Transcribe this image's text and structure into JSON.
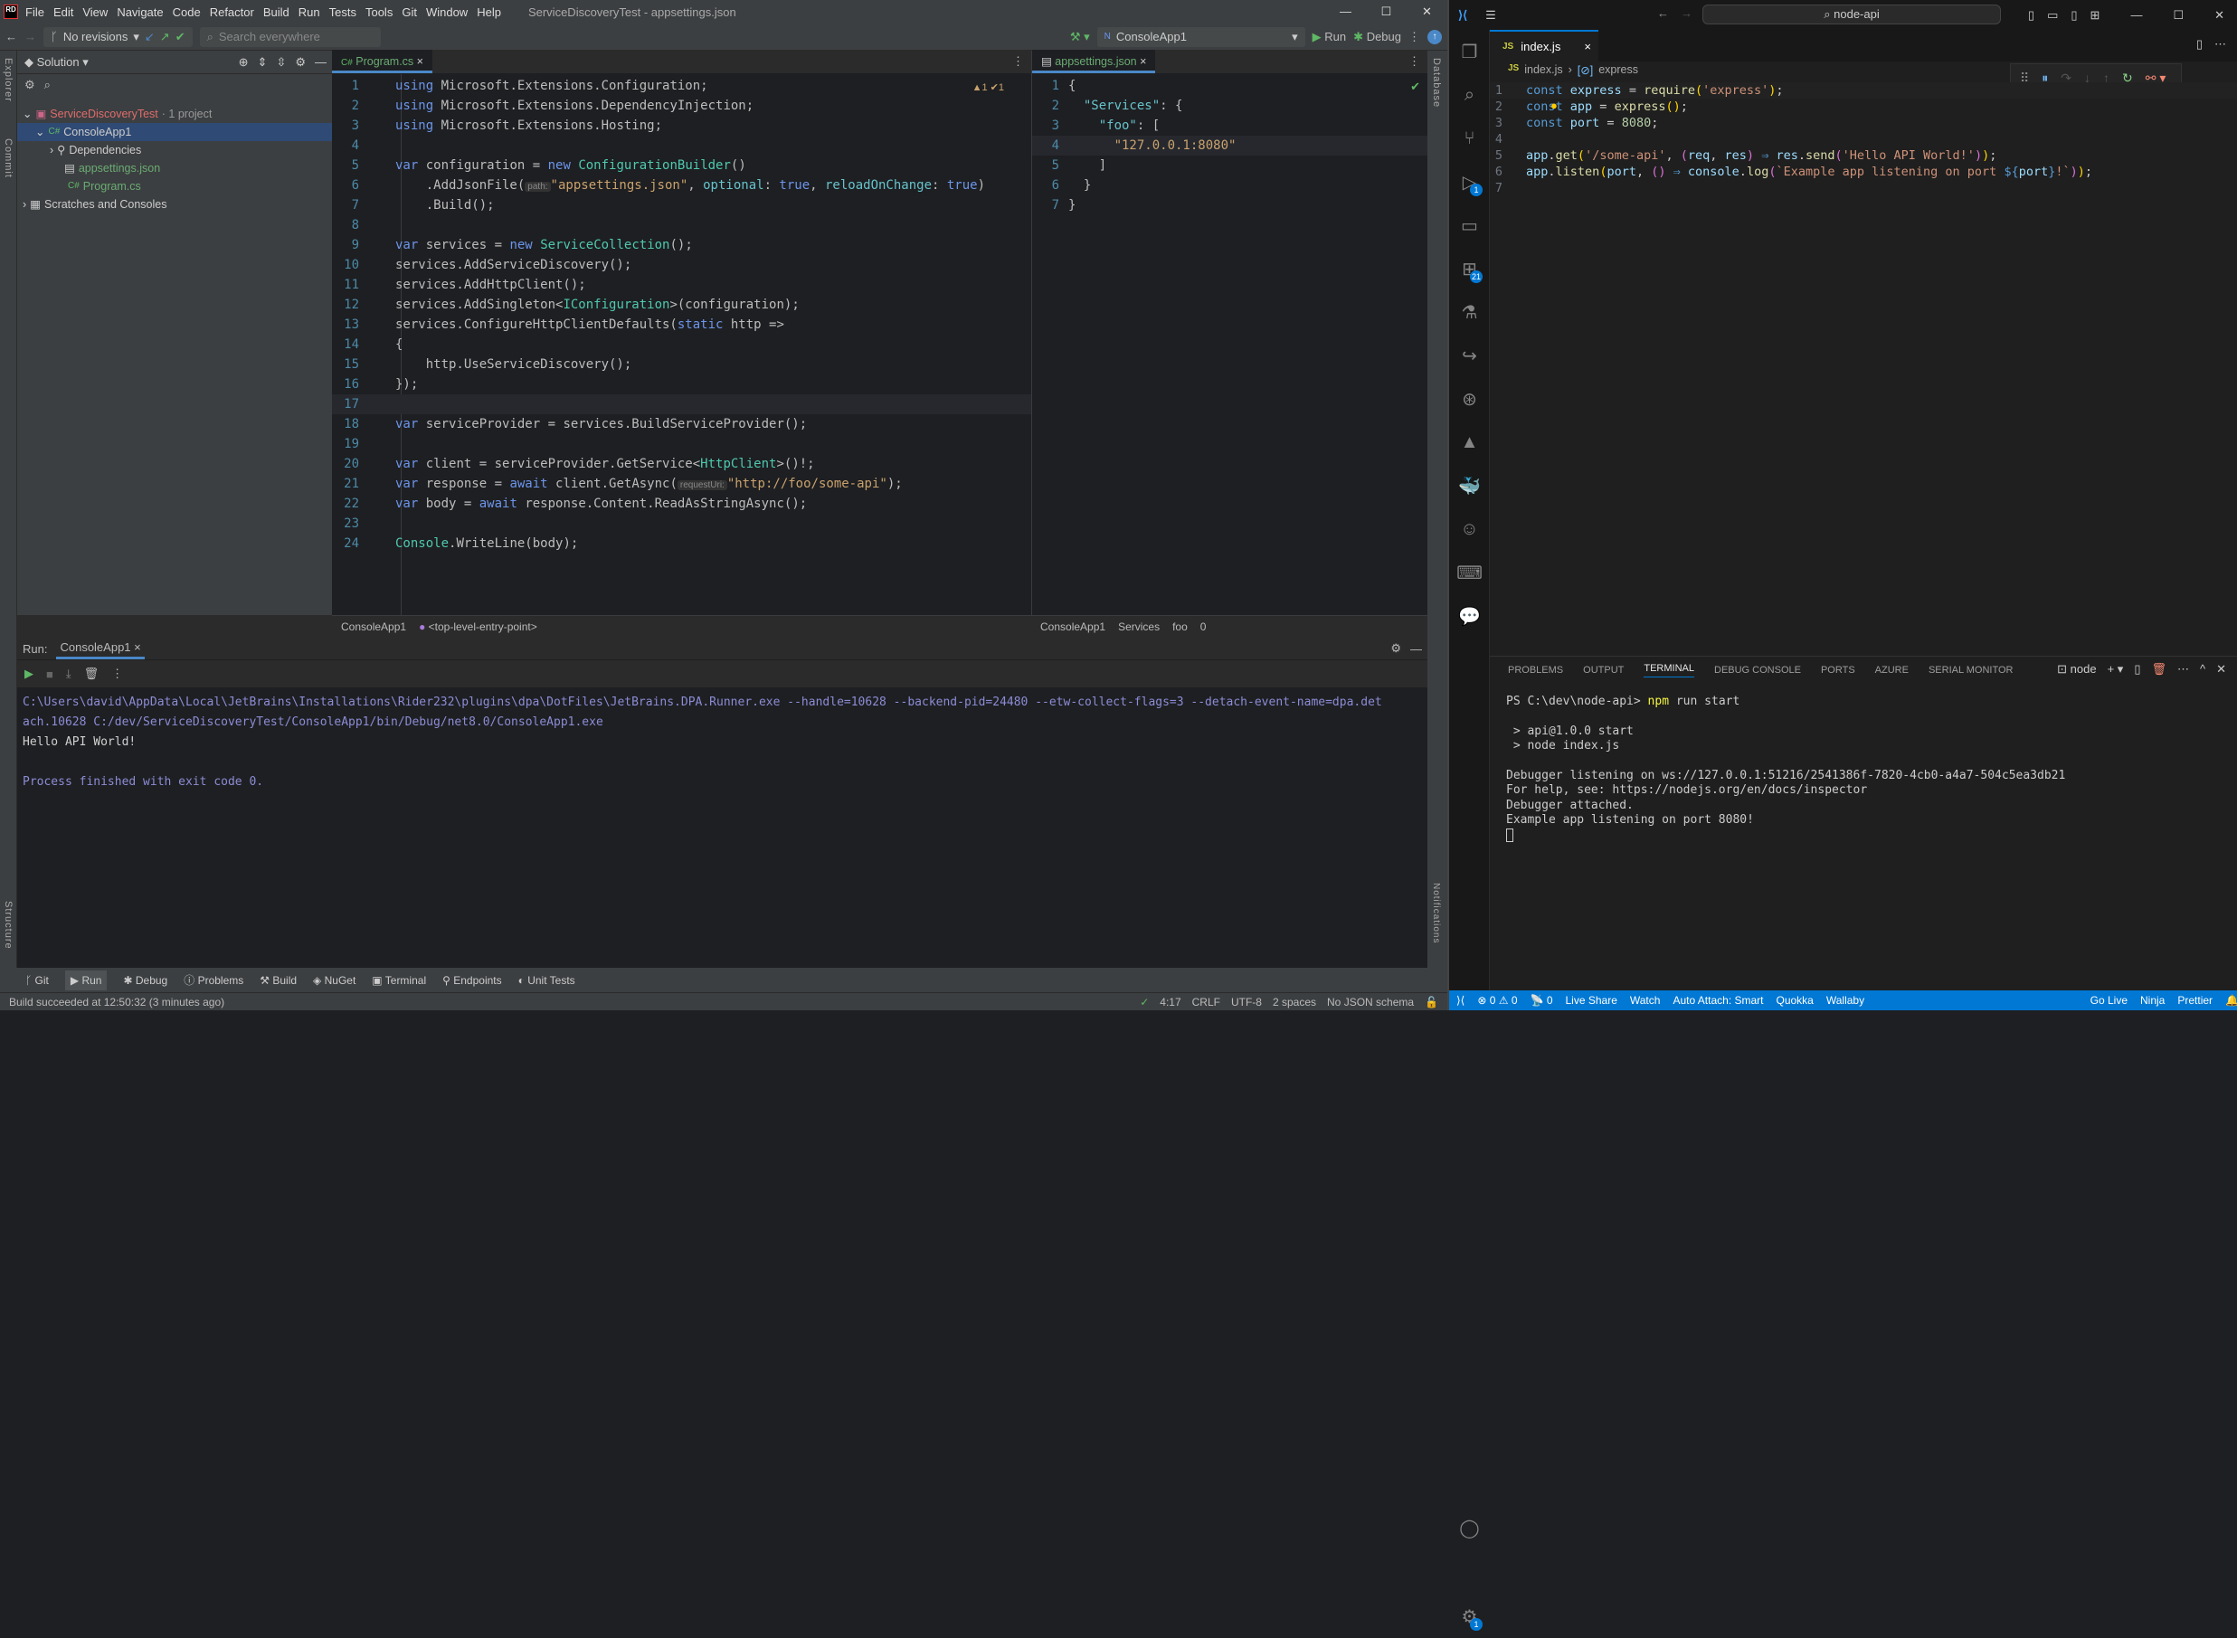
{
  "rider": {
    "logo": "RD",
    "menu": [
      "File",
      "Edit",
      "View",
      "Navigate",
      "Code",
      "Refactor",
      "Build",
      "Run",
      "Tests",
      "Tools",
      "Git",
      "Window",
      "Help"
    ],
    "window_title": "ServiceDiscoveryTest - appsettings.json",
    "toolbar": {
      "vcs": "No revisions",
      "search_placeholder": "Search everywhere",
      "run_config": "ConsoleApp1",
      "run": "Run",
      "debug": "Debug"
    },
    "left_strip": [
      "Explorer",
      "Commit",
      "Structure"
    ],
    "right_strip": [
      "Database",
      "Notifications"
    ],
    "solution": {
      "title": "Solution",
      "items": [
        {
          "label": "ServiceDiscoveryTest",
          "suffix": " · 1 project"
        },
        {
          "label": "ConsoleApp1"
        },
        {
          "label": "Dependencies"
        },
        {
          "label": "appsettings.json"
        },
        {
          "label": "Program.cs"
        },
        {
          "label": "Scratches and Consoles"
        }
      ]
    },
    "program_tab": "Program.cs",
    "inspections": "▲1 ✔1",
    "program_lines": [
      [
        [
          "using",
          "kw"
        ],
        [
          " Microsoft.Extensions.Configuration;",
          "tx"
        ]
      ],
      [
        [
          "using",
          "kw"
        ],
        [
          " Microsoft.Extensions.DependencyInjection;",
          "tx"
        ]
      ],
      [
        [
          "using",
          "kw"
        ],
        [
          " Microsoft.Extensions.Hosting;",
          "tx"
        ]
      ],
      [],
      [
        [
          "var",
          "kw"
        ],
        [
          " configuration = ",
          "tx"
        ],
        [
          "new",
          "kw"
        ],
        [
          " ",
          "tx"
        ],
        [
          "ConfigurationBuilder",
          "cls"
        ],
        [
          "()",
          "tx"
        ]
      ],
      [
        [
          "    .AddJsonFile(",
          "tx"
        ],
        [
          "path:",
          "hint"
        ],
        [
          "\"appsettings.json\"",
          "str"
        ],
        [
          ", ",
          "tx"
        ],
        [
          "optional",
          "key"
        ],
        [
          ": ",
          "tx"
        ],
        [
          "true",
          "kw"
        ],
        [
          ", ",
          "tx"
        ],
        [
          "reloadOnChange",
          "key"
        ],
        [
          ": ",
          "tx"
        ],
        [
          "true",
          "kw"
        ],
        [
          ")",
          "tx"
        ]
      ],
      [
        [
          "    .Build();",
          "tx"
        ]
      ],
      [],
      [
        [
          "var",
          "kw"
        ],
        [
          " services = ",
          "tx"
        ],
        [
          "new",
          "kw"
        ],
        [
          " ",
          "tx"
        ],
        [
          "ServiceCollection",
          "cls"
        ],
        [
          "();",
          "tx"
        ]
      ],
      [
        [
          "services.AddServiceDiscovery();",
          "tx"
        ]
      ],
      [
        [
          "services.AddHttpClient();",
          "tx"
        ]
      ],
      [
        [
          "services.AddSingleton<",
          "tx"
        ],
        [
          "IConfiguration",
          "cls"
        ],
        [
          ">(configuration);",
          "tx"
        ]
      ],
      [
        [
          "services.ConfigureHttpClientDefaults(",
          "tx"
        ],
        [
          "static",
          "kw"
        ],
        [
          " http =>",
          "tx"
        ]
      ],
      [
        [
          "{",
          "tx"
        ]
      ],
      [
        [
          "    http.UseServiceDiscovery();",
          "tx"
        ]
      ],
      [
        [
          "});",
          "tx"
        ]
      ],
      [],
      [
        [
          "var",
          "kw"
        ],
        [
          " serviceProvider = services.BuildServiceProvider();",
          "tx"
        ]
      ],
      [],
      [
        [
          "var",
          "kw"
        ],
        [
          " client = serviceProvider.GetService<",
          "tx"
        ],
        [
          "HttpClient",
          "cls"
        ],
        [
          ">()!;",
          "tx"
        ]
      ],
      [
        [
          "var",
          "kw"
        ],
        [
          " response = ",
          "tx"
        ],
        [
          "await",
          "kw"
        ],
        [
          " client.GetAsync(",
          "tx"
        ],
        [
          "requestUri:",
          "hint"
        ],
        [
          "\"http://foo/some-api\"",
          "str"
        ],
        [
          ");",
          "tx"
        ]
      ],
      [
        [
          "var",
          "kw"
        ],
        [
          " body = ",
          "tx"
        ],
        [
          "await",
          "kw"
        ],
        [
          " response.Content.ReadAsStringAsync();",
          "tx"
        ]
      ],
      [],
      [
        [
          "Console",
          "cls"
        ],
        [
          ".WriteLine(body);",
          "tx"
        ]
      ]
    ],
    "json_tab": "appsettings.json",
    "json_lines": [
      [
        [
          "{",
          "tx"
        ]
      ],
      [
        [
          "  ",
          "tx"
        ],
        [
          "\"Services\"",
          "key"
        ],
        [
          ": {",
          "tx"
        ]
      ],
      [
        [
          "    ",
          "tx"
        ],
        [
          "\"foo\"",
          "key"
        ],
        [
          ": [",
          "tx"
        ]
      ],
      [
        [
          "      ",
          "tx"
        ],
        [
          "\"127.0.0.1:8080\"",
          "str"
        ]
      ],
      [
        [
          "    ]",
          "tx"
        ]
      ],
      [
        [
          "  }",
          "tx"
        ]
      ],
      [
        [
          "}",
          "tx"
        ]
      ]
    ],
    "breadcrumb_left": [
      "ConsoleApp1",
      "<top-level-entry-point>"
    ],
    "breadcrumb_right": [
      "ConsoleApp1",
      "Services",
      "foo",
      "0"
    ],
    "run": {
      "label": "Run:",
      "tab": "ConsoleApp1",
      "output": [
        {
          "text": "C:\\Users\\david\\AppData\\Local\\JetBrains\\Installations\\Rider232\\plugins\\dpa\\DotFiles\\JetBrains.DPA.Runner.exe --handle=10628 --backend-pid=24480 --etw-collect-flags=3 --detach-event-name=dpa.det",
          "color": "#8c8cd6"
        },
        {
          "text": "ach.10628 C:/dev/ServiceDiscoveryTest/ConsoleApp1/bin/Debug/net8.0/ConsoleApp1.exe",
          "color": "#8c8cd6"
        },
        {
          "text": "Hello API World!",
          "color": "#d0d0d0"
        },
        {
          "text": "",
          "color": "#d0d0d0"
        },
        {
          "text": "Process finished with exit code 0.",
          "color": "#8c8cd6"
        }
      ]
    },
    "bottom_tools": [
      "Git",
      "Run",
      "Debug",
      "Problems",
      "Build",
      "NuGet",
      "Terminal",
      "Endpoints",
      "Unit Tests"
    ],
    "status": {
      "message": "Build succeeded at 12:50:32 (3 minutes ago)",
      "position": "4:17",
      "line_sep": "CRLF",
      "encoding": "UTF-8",
      "indent": "2 spaces",
      "schema": "No JSON schema"
    }
  },
  "vscode": {
    "search": "node-api",
    "tab": "index.js",
    "breadcrumb": [
      "index.js",
      "express"
    ],
    "activity_badges": {
      "debug": "1",
      "extensions": "21",
      "settings": "1"
    },
    "lines": [
      [
        [
          "const",
          "ck"
        ],
        [
          " ",
          "cw"
        ],
        [
          "express",
          "cv"
        ],
        [
          " = ",
          "cw"
        ],
        [
          "require",
          "cf"
        ],
        [
          "(",
          "cb"
        ],
        [
          "'express'",
          "cs"
        ],
        [
          ")",
          "cb"
        ],
        [
          ";",
          "cw"
        ]
      ],
      [
        [
          "const",
          "ck"
        ],
        [
          " ",
          "cw"
        ],
        [
          "app",
          "cv"
        ],
        [
          " = ",
          "cw"
        ],
        [
          "express",
          "cf"
        ],
        [
          "()",
          "cb"
        ],
        [
          ";",
          "cw"
        ]
      ],
      [
        [
          "const",
          "ck"
        ],
        [
          " ",
          "cw"
        ],
        [
          "port",
          "cv"
        ],
        [
          " = ",
          "cw"
        ],
        [
          "8080",
          "cn"
        ],
        [
          ";",
          "cw"
        ]
      ],
      [],
      [
        [
          "app",
          "cv"
        ],
        [
          ".",
          "cw"
        ],
        [
          "get",
          "cf"
        ],
        [
          "(",
          "cb"
        ],
        [
          "'/some-api'",
          "cs"
        ],
        [
          ", ",
          "cw"
        ],
        [
          "(",
          "cp"
        ],
        [
          "req",
          "cv"
        ],
        [
          ", ",
          "cw"
        ],
        [
          "res",
          "cv"
        ],
        [
          ")",
          "cp"
        ],
        [
          " ⇒ ",
          "ck"
        ],
        [
          "res",
          "cv"
        ],
        [
          ".",
          "cw"
        ],
        [
          "send",
          "cf"
        ],
        [
          "(",
          "cp"
        ],
        [
          "'Hello API World!'",
          "cs"
        ],
        [
          ")",
          "cp"
        ],
        [
          ")",
          "cb"
        ],
        [
          ";",
          "cw"
        ]
      ],
      [
        [
          "app",
          "cv"
        ],
        [
          ".",
          "cw"
        ],
        [
          "listen",
          "cf"
        ],
        [
          "(",
          "cb"
        ],
        [
          "port",
          "cv"
        ],
        [
          ", ",
          "cw"
        ],
        [
          "()",
          "cp"
        ],
        [
          " ⇒ ",
          "ck"
        ],
        [
          "console",
          "cv"
        ],
        [
          ".",
          "cw"
        ],
        [
          "log",
          "cf"
        ],
        [
          "(",
          "cp"
        ],
        [
          "`Example app listening on port ",
          "cs"
        ],
        [
          "${",
          "ck"
        ],
        [
          "port",
          "cv"
        ],
        [
          "}",
          "ck"
        ],
        [
          "!`",
          "cs"
        ],
        [
          ")",
          "cp"
        ],
        [
          ")",
          "cb"
        ],
        [
          ";",
          "cw"
        ]
      ],
      []
    ],
    "panel_tabs": [
      "PROBLEMS",
      "OUTPUT",
      "TERMINAL",
      "DEBUG CONSOLE",
      "PORTS",
      "AZURE",
      "SERIAL MONITOR"
    ],
    "active_panel_tab": "TERMINAL",
    "terminal_name": "node",
    "terminal": {
      "prompt": "PS C:\\dev\\node-api> ",
      "command_bin": "npm",
      "command_rest": " run start",
      "lines": [
        "",
        " > api@1.0.0 start",
        " > node index.js",
        "",
        "Debugger listening on ws://127.0.0.1:51216/2541386f-7820-4cb0-a4a7-504c5ea3db21",
        "For help, see: https://nodejs.org/en/docs/inspector",
        "Debugger attached.",
        "Example app listening on port 8080!"
      ]
    },
    "status": [
      "⊗ 0 ⚠ 0",
      "📡 0",
      "Live Share",
      "Watch",
      "Auto Attach: Smart",
      "Quokka",
      "Wallaby"
    ],
    "status_right": [
      "Go Live",
      "Ninja",
      "Prettier"
    ]
  }
}
